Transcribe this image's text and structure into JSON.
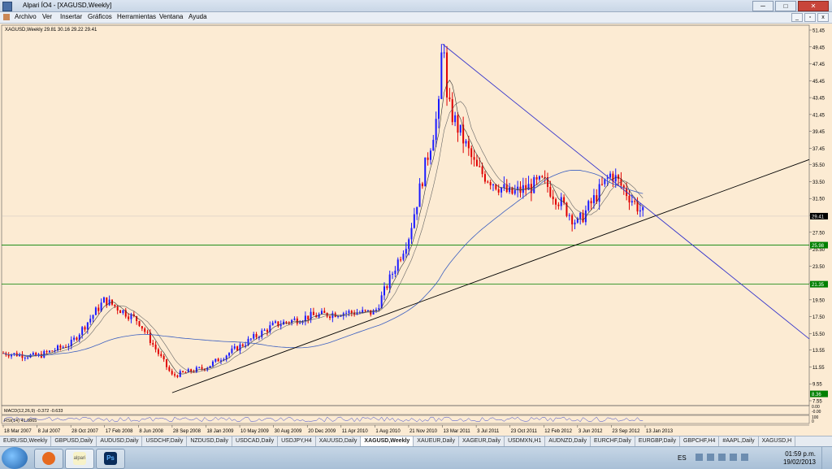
{
  "window": {
    "title": "Alpari ÍO4 - [XAGUSD,Weekly]",
    "min": "─",
    "max": "□",
    "close": "✕"
  },
  "menu": [
    "Archivo",
    "Ver",
    "Insertar",
    "Gráficos",
    "Herramientas",
    "Ventana",
    "Ayuda"
  ],
  "mdi": {
    "min": "_",
    "restore": "▫",
    "close": "x"
  },
  "chart": {
    "header": "XAGUSD,Weekly  29.81 30.16 29.22 29.41",
    "price_labels": [
      "51.45",
      "49.45",
      "47.45",
      "45.45",
      "43.45",
      "41.45",
      "39.45",
      "37.45",
      "35.50",
      "33.50",
      "31.50",
      "29.50",
      "27.50",
      "25.50",
      "23.50",
      "21.50",
      "19.50",
      "17.50",
      "15.50",
      "13.55",
      "11.55",
      "9.55",
      "7.55"
    ],
    "current_price": "29.41",
    "hline_labels": [
      "25.98",
      "21.35"
    ],
    "time_labels": [
      "18 Mar 2007",
      "8 Jul 2007",
      "28 Oct 2007",
      "17 Feb 2008",
      "8 Jun 2008",
      "28 Sep 2008",
      "18 Jan 2009",
      "10 May 2009",
      "30 Aug 2009",
      "20 Dec 2009",
      "11 Apr 2010",
      "1 Aug 2010",
      "21 Nov 2010",
      "13 Mar 2011",
      "3 Jul 2011",
      "23 Oct 2011",
      "12 Feb 2012",
      "3 Jun 2012",
      "23 Sep 2012",
      "13 Jan 2013"
    ],
    "low_label": "8.36",
    "macd_label": "MACD(12,26,9) -0.372 -0.633",
    "rsi_label": "RSI(14) 41.0865",
    "sub_scale": [
      "0.00",
      "-0.00",
      "100",
      "0"
    ],
    "colors": {
      "bg": "#fcebd3",
      "bull": "#1a1aff",
      "bear": "#e00000",
      "support": "#008000",
      "trend": "#000000",
      "resist": "#3333cc",
      "ma_long": "#3b5fc0"
    }
  },
  "chart_data": {
    "type": "candlestick",
    "title": "XAGUSD,Weekly",
    "xlabel": "",
    "ylabel": "",
    "ylim": [
      7.55,
      51.45
    ],
    "close_path": [
      [
        "18 Mar 2007",
        13.2
      ],
      [
        "8 Jul 2007",
        12.8
      ],
      [
        "28 Oct 2007",
        14.3
      ],
      [
        "17 Feb 2008",
        19.5
      ],
      [
        "8 Jun 2008",
        17.0
      ],
      [
        "28 Sep 2008",
        10.5
      ],
      [
        "18 Jan 2009",
        11.5
      ],
      [
        "10 May 2009",
        14.0
      ],
      [
        "30 Aug 2009",
        16.5
      ],
      [
        "20 Dec 2009",
        17.5
      ],
      [
        "11 Apr 2010",
        18.0
      ],
      [
        "1 Aug 2010",
        18.0
      ],
      [
        "21 Nov 2010",
        27.0
      ],
      [
        "13 Mar 2011",
        44.0
      ],
      [
        "3 Jul 2011",
        35.0
      ],
      [
        "23 Oct 2011",
        32.0
      ],
      [
        "12 Feb 2012",
        33.5
      ],
      [
        "3 Jun 2012",
        28.5
      ],
      [
        "23 Sep 2012",
        34.5
      ],
      [
        "13 Jan 2013",
        29.41
      ]
    ],
    "high": 49.8,
    "low": 8.36,
    "horizontal_lines": [
      25.98,
      21.35
    ],
    "trendlines": [
      {
        "name": "support",
        "from": [
          "28 Sep 2008",
          8.5
        ],
        "to": [
          "13 Jan 2013",
          29.0
        ]
      },
      {
        "name": "resistance",
        "from": [
          "13 Mar 2011",
          49.8
        ],
        "to": [
          "13 Jan 2013",
          30.5
        ]
      }
    ]
  },
  "tabs": [
    "EURUSD,Weekly",
    "GBPUSD,Daily",
    "AUDUSD,Daily",
    "USDCHF,Daily",
    "NZDUSD,Daily",
    "USDCAD,Daily",
    "USDJPY,H4",
    "XAUUSD,Daily",
    "XAGUSD,Weekly",
    "XAUEUR,Daily",
    "XAGEUR,Daily",
    "USDMXN,H1",
    "AUDNZD,Daily",
    "EURCHF,Daily",
    "EURGBP,Daily",
    "GBPCHF,H4",
    "#AAPL,Daily",
    "XAGUSD,H"
  ],
  "active_tab": 8,
  "taskbar": {
    "apps": [
      {
        "name": "firefox-icon",
        "label": ""
      },
      {
        "name": "alpari-icon",
        "label": "alpari"
      },
      {
        "name": "photoshop-icon",
        "label": "Ps"
      }
    ],
    "lang": "ES",
    "time": "01:59 p.m.",
    "date": "19/02/2013"
  }
}
